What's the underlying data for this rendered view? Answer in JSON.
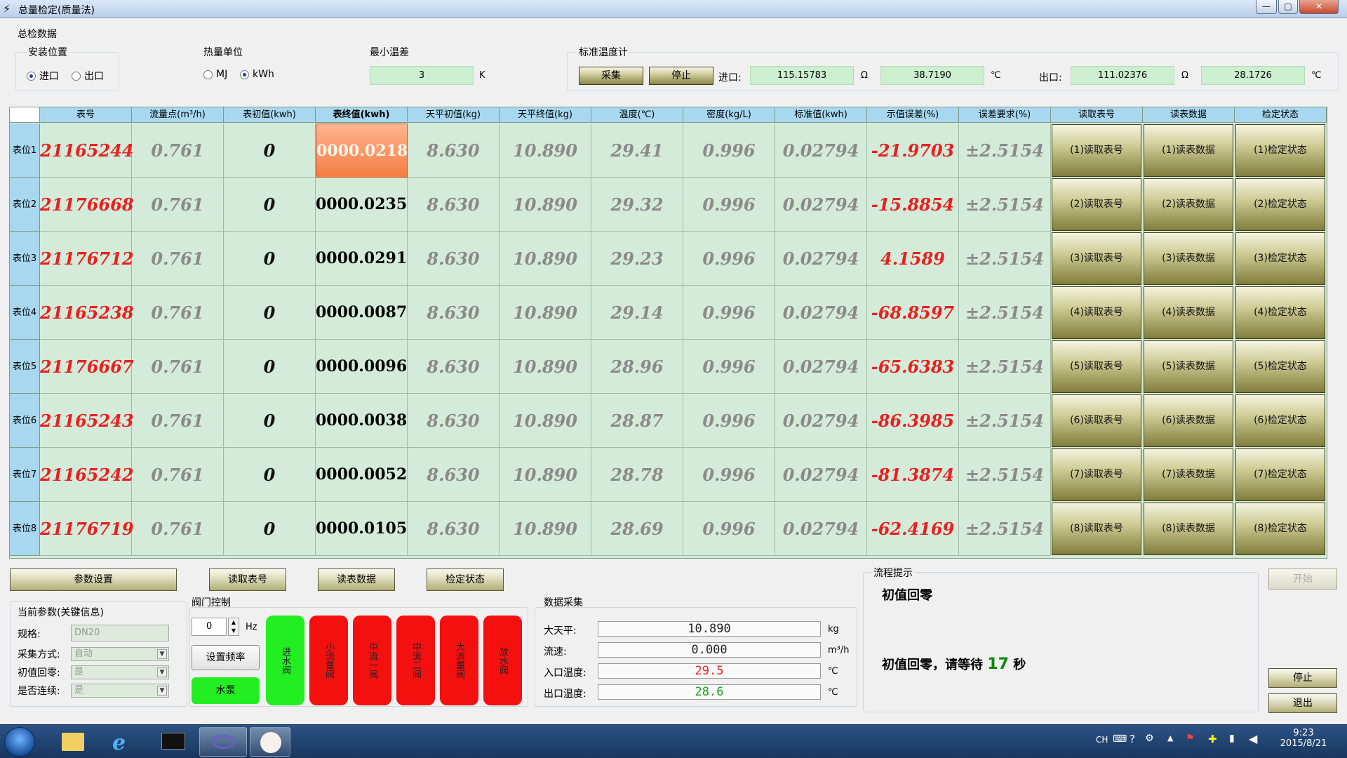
{
  "window": {
    "title": "总量检定(质量法)",
    "icon": "lightning-icon",
    "min": "—",
    "max": "▢",
    "close": "✕"
  },
  "total_section": {
    "title": "总检数据"
  },
  "install": {
    "title": "安装位置",
    "opt1": "进口",
    "opt2": "出口",
    "selected": "进口"
  },
  "heat_unit": {
    "title": "热量单位",
    "opt1": "MJ",
    "opt2": "kWh",
    "selected": "kWh"
  },
  "min_temp": {
    "title": "最小温差",
    "value": "3",
    "unit": "K"
  },
  "std_thermo": {
    "title": "标准温度计",
    "collect": "采集",
    "stop": "停止",
    "inlet_label": "进口:",
    "inlet_res": "115.15783",
    "ohm": "Ω",
    "inlet_temp": "38.7190",
    "deg": "℃",
    "outlet_label": "出口:",
    "outlet_res": "111.02376",
    "outlet_temp": "28.1726"
  },
  "table": {
    "headers": [
      "表号",
      "流量点(m³/h)",
      "表初值(kwh)",
      "表终值(kwh)",
      "天平初值(kg)",
      "天平终值(kg)",
      "温度(℃)",
      "密度(kg/L)",
      "标准值(kwh)",
      "示值误差(%)",
      "误差要求(%)",
      "读取表号",
      "读表数据",
      "检定状态"
    ],
    "rows": [
      {
        "pos": "表位1",
        "id": "21165244",
        "flow": "0.761",
        "init": "0",
        "final": "0000.0218",
        "bal_init": "8.630",
        "bal_final": "10.890",
        "temp": "29.41",
        "density": "0.996",
        "std": "0.02794",
        "err": "-21.9703",
        "req": "±2.5154",
        "b1": "(1)读取表号",
        "b2": "(1)读表数据",
        "b3": "(1)检定状态"
      },
      {
        "pos": "表位2",
        "id": "21176668",
        "flow": "0.761",
        "init": "0",
        "final": "0000.0235",
        "bal_init": "8.630",
        "bal_final": "10.890",
        "temp": "29.32",
        "density": "0.996",
        "std": "0.02794",
        "err": "-15.8854",
        "req": "±2.5154",
        "b1": "(2)读取表号",
        "b2": "(2)读表数据",
        "b3": "(2)检定状态"
      },
      {
        "pos": "表位3",
        "id": "21176712",
        "flow": "0.761",
        "init": "0",
        "final": "0000.0291",
        "bal_init": "8.630",
        "bal_final": "10.890",
        "temp": "29.23",
        "density": "0.996",
        "std": "0.02794",
        "err": "4.1589",
        "req": "±2.5154",
        "b1": "(3)读取表号",
        "b2": "(3)读表数据",
        "b3": "(3)检定状态"
      },
      {
        "pos": "表位4",
        "id": "21165238",
        "flow": "0.761",
        "init": "0",
        "final": "0000.0087",
        "bal_init": "8.630",
        "bal_final": "10.890",
        "temp": "29.14",
        "density": "0.996",
        "std": "0.02794",
        "err": "-68.8597",
        "req": "±2.5154",
        "b1": "(4)读取表号",
        "b2": "(4)读表数据",
        "b3": "(4)检定状态"
      },
      {
        "pos": "表位5",
        "id": "21176667",
        "flow": "0.761",
        "init": "0",
        "final": "0000.0096",
        "bal_init": "8.630",
        "bal_final": "10.890",
        "temp": "28.96",
        "density": "0.996",
        "std": "0.02794",
        "err": "-65.6383",
        "req": "±2.5154",
        "b1": "(5)读取表号",
        "b2": "(5)读表数据",
        "b3": "(5)检定状态"
      },
      {
        "pos": "表位6",
        "id": "21165243",
        "flow": "0.761",
        "init": "0",
        "final": "0000.0038",
        "bal_init": "8.630",
        "bal_final": "10.890",
        "temp": "28.87",
        "density": "0.996",
        "std": "0.02794",
        "err": "-86.3985",
        "req": "±2.5154",
        "b1": "(6)读取表号",
        "b2": "(6)读表数据",
        "b3": "(6)检定状态"
      },
      {
        "pos": "表位7",
        "id": "21165242",
        "flow": "0.761",
        "init": "0",
        "final": "0000.0052",
        "bal_init": "8.630",
        "bal_final": "10.890",
        "temp": "28.78",
        "density": "0.996",
        "std": "0.02794",
        "err": "-81.3874",
        "req": "±2.5154",
        "b1": "(7)读取表号",
        "b2": "(7)读表数据",
        "b3": "(7)检定状态"
      },
      {
        "pos": "表位8",
        "id": "21176719",
        "flow": "0.761",
        "init": "0",
        "final": "0000.0105",
        "bal_init": "8.630",
        "bal_final": "10.890",
        "temp": "28.69",
        "density": "0.996",
        "std": "0.02794",
        "err": "-62.4169",
        "req": "±2.5154",
        "b1": "(8)读取表号",
        "b2": "(8)读表数据",
        "b3": "(8)检定状态"
      }
    ]
  },
  "actions": {
    "params": "参数设置",
    "read_id": "读取表号",
    "read_data": "读表数据",
    "verify": "检定状态"
  },
  "current": {
    "title": "当前参数(关键信息)",
    "spec_label": "规格:",
    "spec_value": "DN20",
    "mode_label": "采集方式:",
    "mode_value": "自动",
    "zero_label": "初值回零:",
    "zero_value": "是",
    "cont_label": "是否连续:",
    "cont_value": "是"
  },
  "valve": {
    "title": "阀门控制",
    "freq_value": "0",
    "hz": "Hz",
    "set_freq": "设置频率",
    "pump": "水泵",
    "valves": [
      "进水阀",
      "小流量阀",
      "中流一阀",
      "中流二阀",
      "大流量阀",
      "放水阀"
    ]
  },
  "acq": {
    "title": "数据采集",
    "bal_label": "大天平:",
    "bal_value": "10.890",
    "bal_unit": "kg",
    "flow_label": "流速:",
    "flow_value": "0.000",
    "flow_unit": "m³/h",
    "in_label": "入口温度:",
    "in_value": "29.5",
    "in_unit": "℃",
    "out_label": "出口温度:",
    "out_value": "28.6",
    "out_unit": "℃"
  },
  "process": {
    "title": "流程提示",
    "line1": "初值回零",
    "line2_prefix": "初值回零，请等待",
    "countdown": "17",
    "line2_suffix": "秒"
  },
  "right_buttons": {
    "start": "开始",
    "stop": "停止",
    "exit": "退出"
  },
  "taskbar": {
    "lang": "CH",
    "time": "9:23",
    "date": "2015/8/21"
  }
}
